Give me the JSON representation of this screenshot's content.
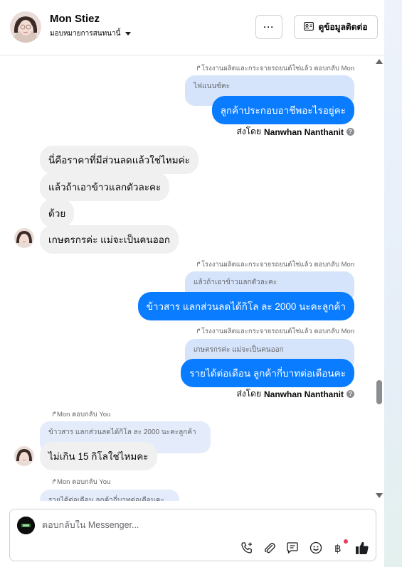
{
  "header": {
    "name": "Mon Stiez",
    "assign_label": "มอบหมายการสนทนานี้",
    "more_label": "···",
    "contact_label": "ดูข้อมูลติดต่อ"
  },
  "messages": {
    "m1_meta": "โรงงานผลิตและกระจายรถยนต์ใช่แล้ว ตอบกลับ Mon",
    "m1_quote": "ไฟแนนซ์คะ",
    "m1_text": "ลูกค้าประกอบอาชีพอะไรอยู่คะ",
    "sent1_prefix": "ส่งโดย",
    "sent1_name": "Nanwhan Nanthanit",
    "in1": "นี่คือราคาที่มีส่วนลดแล้วใช่ไหมค่ะ",
    "in2": "แล้วถ้าเอาข้าวแลกตัวละคะ",
    "in3": "ด้วย",
    "in4": "เกษตรกรค่ะ แม่จะเป็นคนออก",
    "m2_meta": "โรงงานผลิตและกระจายรถยนต์ใช่แล้ว ตอบกลับ Mon",
    "m2_quote": "แล้วถ้าเอาข้าวแลกตัวละคะ",
    "m2_text": "ข้าวสาร แลกส่วนลดได้กิโล ละ 2000 นะคะลูกค้า",
    "m3_meta": "โรงงานผลิตและกระจายรถยนต์ใช่แล้ว ตอบกลับ Mon",
    "m3_quote": "เกษตรกรค่ะ แม่จะเป็นคนออก",
    "m3_text": "รายได้ต่อเดือน ลูกค้ากี่บาทต่อเดือนคะ",
    "sent2_prefix": "ส่งโดย",
    "sent2_name": "Nanwhan Nanthanit",
    "in5_meta": "Mon ตอบกลับ You",
    "in5_quote": "ข้าวสาร แลกส่วนลดได้กิโล ละ 2000 นะคะลูกค้า",
    "in5_text": "ไม่เกิน 15 กิโลใช่ไหมคะ",
    "in6_meta": "Mon ตอบกลับ You",
    "in6_quote": "รายได้ต่อเดือน ลูกค้ากี่บาทต่อเดือนคะ"
  },
  "composer": {
    "placeholder": "ตอบกลับใน Messenger..."
  },
  "colors": {
    "outgoing": "#0a7cff",
    "incoming": "#f0f0f0",
    "reply_quote": "#d6e4fb"
  },
  "icons": [
    "more-icon",
    "contact-card-icon",
    "call-icon",
    "attach-icon",
    "saved-reply-icon",
    "emoji-icon",
    "baht-icon",
    "like-icon"
  ]
}
